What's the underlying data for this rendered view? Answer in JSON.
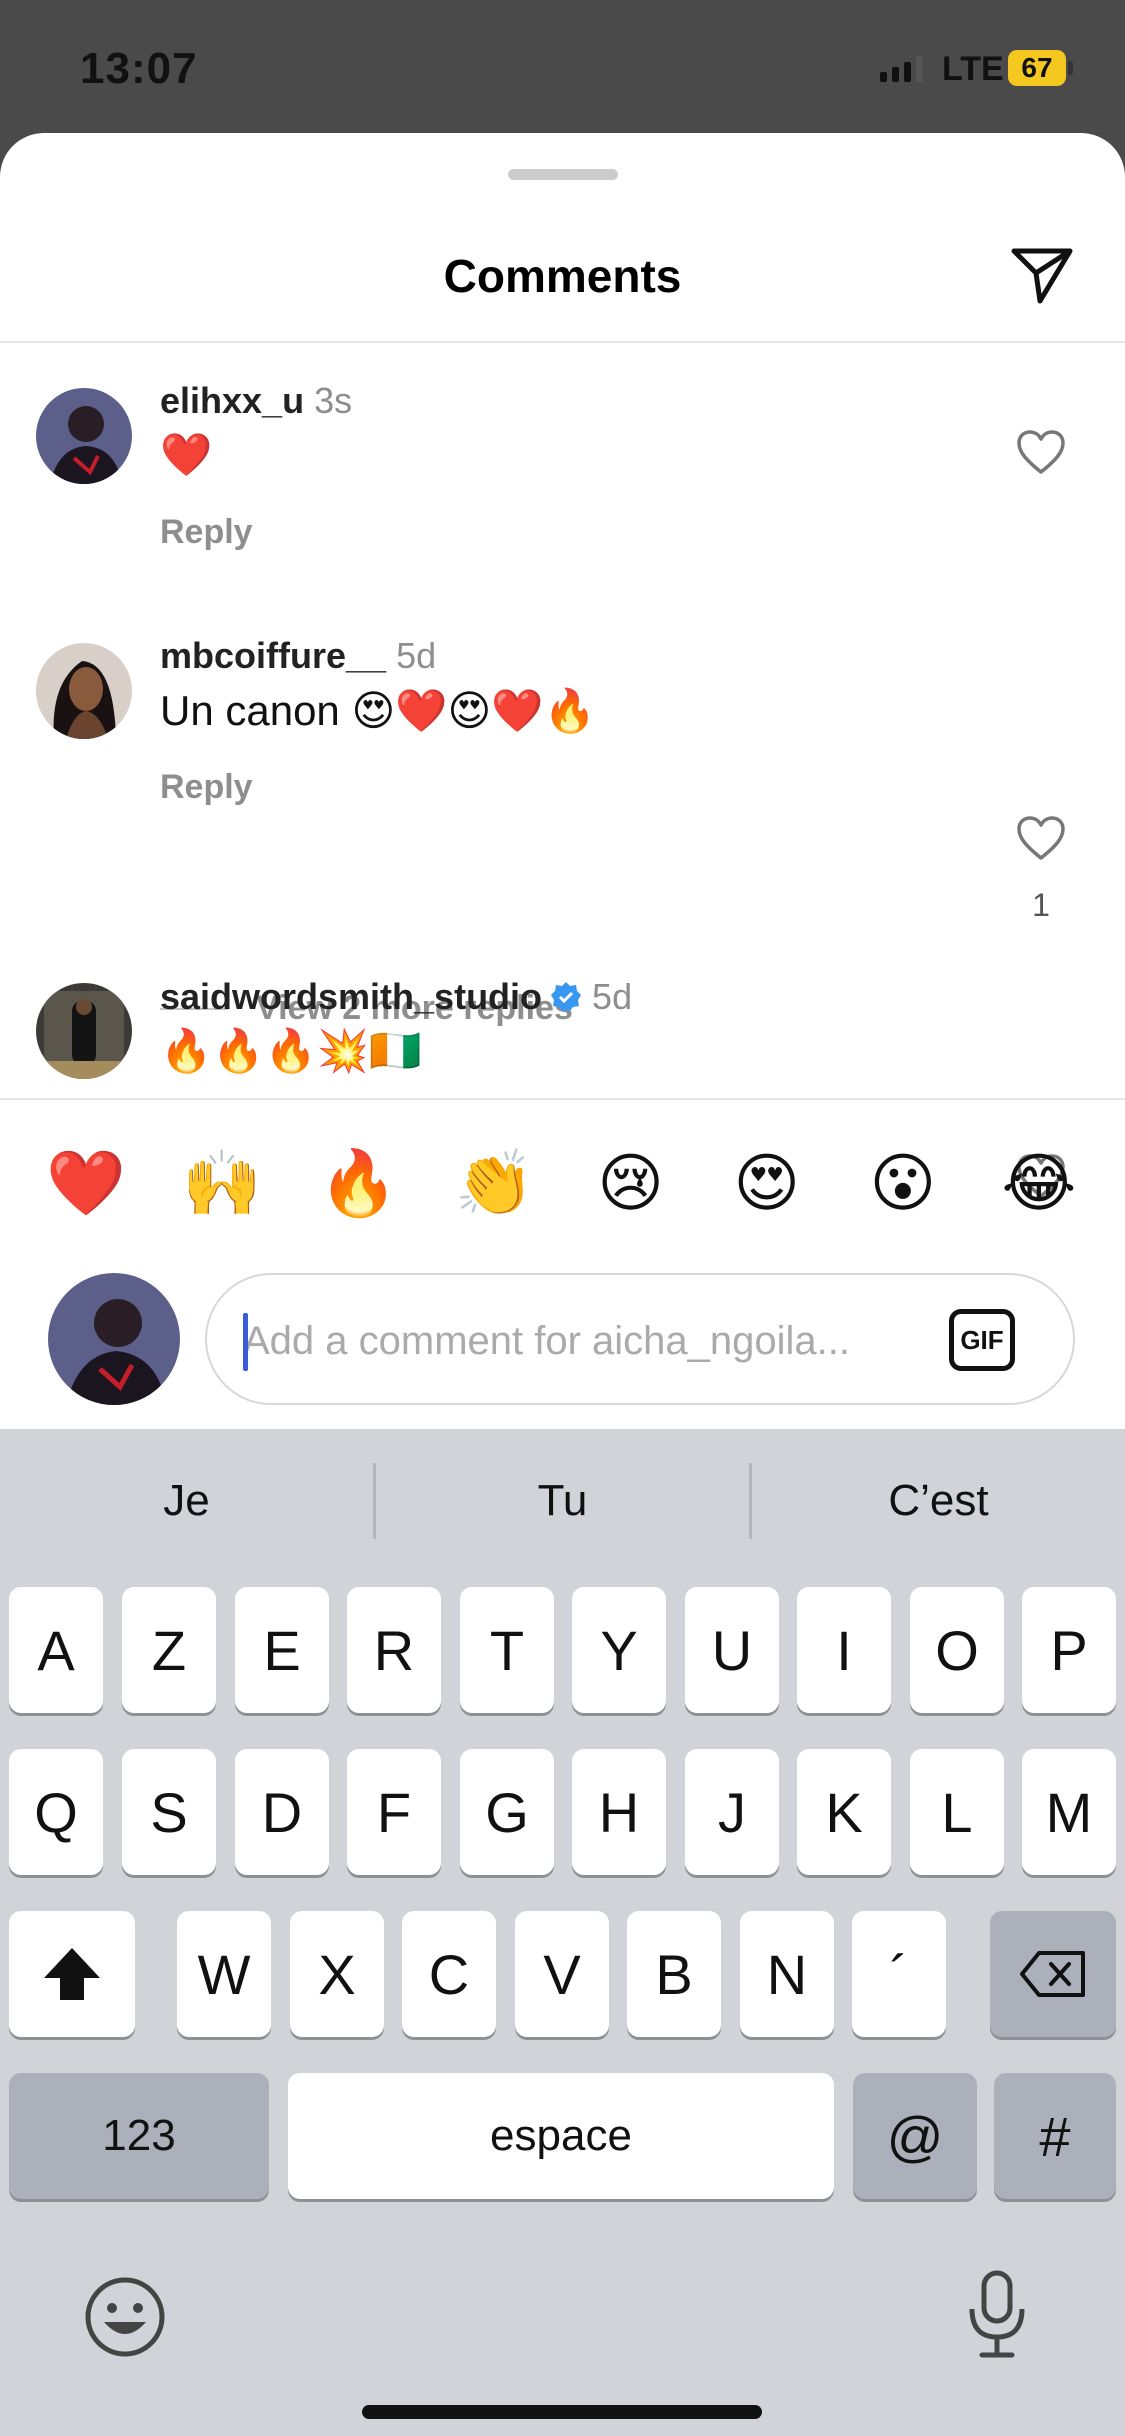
{
  "status_bar": {
    "time": "13:07",
    "network": "LTE",
    "battery": "67"
  },
  "sheet": {
    "title": "Comments"
  },
  "comments": [
    {
      "username": "elihxx_u",
      "time": "3s",
      "text": "❤️",
      "reply": "Reply",
      "likes": ""
    },
    {
      "username": "mbcoiffure__",
      "time": "5d",
      "text": "Un canon 😍❤️😍❤️🔥",
      "reply": "Reply",
      "likes": "1"
    },
    {
      "username": "saidwordsmith_studio",
      "time": "5d",
      "text": "🔥🔥🔥💥🇨🇮",
      "verified": true,
      "likes": ""
    }
  ],
  "more_replies": "View 2 more replies",
  "quick_reactions": [
    "❤️",
    "🙌",
    "🔥",
    "👏",
    "😢",
    "😍",
    "😮",
    "😂"
  ],
  "composer": {
    "placeholder": "Add a comment for aicha_ngoila...",
    "gif_label": "GIF"
  },
  "keyboard": {
    "suggestions": [
      "Je",
      "Tu",
      "C’est"
    ],
    "row1": [
      "A",
      "Z",
      "E",
      "R",
      "T",
      "Y",
      "U",
      "I",
      "O",
      "P"
    ],
    "row2": [
      "Q",
      "S",
      "D",
      "F",
      "G",
      "H",
      "J",
      "K",
      "L",
      "M"
    ],
    "row3": [
      "W",
      "X",
      "C",
      "V",
      "B",
      "N",
      "´"
    ],
    "numbers_key": "123",
    "space_key": "espace",
    "at_key": "@",
    "hash_key": "#"
  }
}
